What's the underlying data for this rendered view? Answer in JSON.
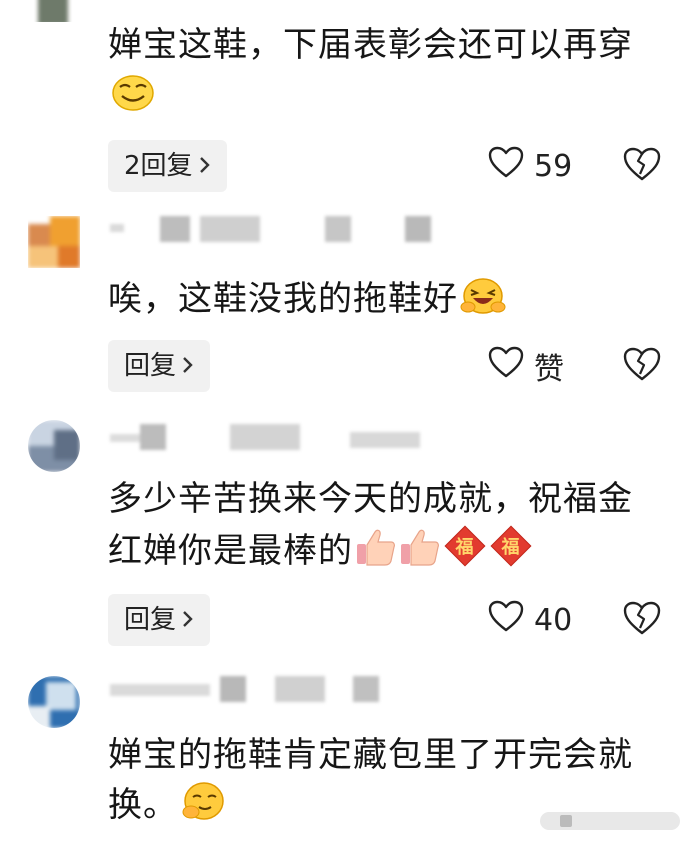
{
  "comments": [
    {
      "text": "婵宝这鞋，下届表彰会还可以再穿",
      "emojis": [
        "grinning-squint-emoji"
      ],
      "reply_label": "2回复",
      "like_count": "59"
    },
    {
      "text": "唉，这鞋没我的拖鞋好",
      "emojis": [
        "laughing-hug-emoji"
      ],
      "reply_label": "回复",
      "like_count": "赞"
    },
    {
      "text": "多少辛苦换来今天的成就，祝福金红婵你是最棒的",
      "emojis": [
        "thumbs-up-emoji",
        "thumbs-up-emoji",
        "fu-emoji",
        "fu-emoji"
      ],
      "reply_label": "回复",
      "like_count": "40"
    },
    {
      "text": "婵宝的拖鞋肯定藏包里了开完会就换。",
      "emojis": [
        "shy-smile-emoji"
      ],
      "reply_label": "",
      "like_count": ""
    }
  ],
  "icons": {
    "like": "heart-outline-icon",
    "dislike": "broken-heart-icon",
    "chevron": "chevron-right-icon"
  },
  "colors": {
    "reply_bg": "#f1f1f1",
    "text": "#161616",
    "fu_red": "#e23b2f"
  }
}
